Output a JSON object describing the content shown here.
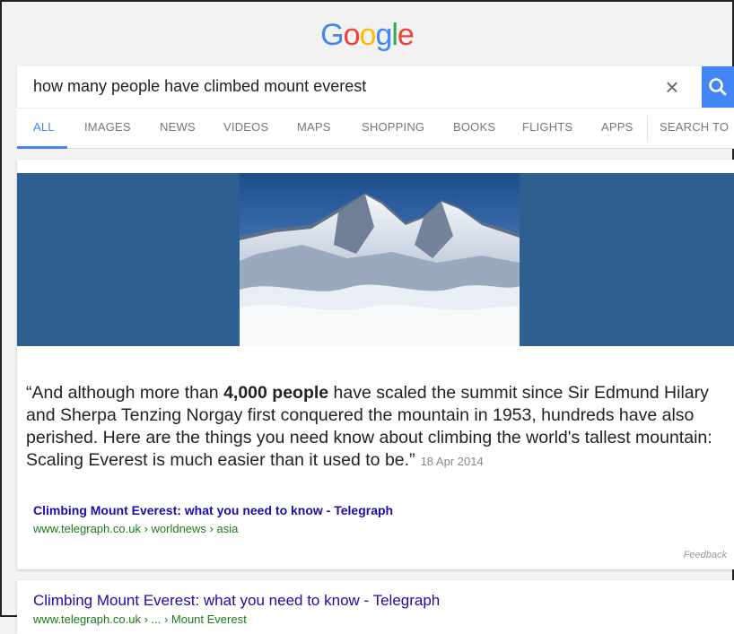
{
  "header": {
    "logo_letters": [
      {
        "ch": "G",
        "color": "#4285f4"
      },
      {
        "ch": "o",
        "color": "#ea4335"
      },
      {
        "ch": "o",
        "color": "#fbbc05"
      },
      {
        "ch": "g",
        "color": "#4285f4"
      },
      {
        "ch": "l",
        "color": "#34a853"
      },
      {
        "ch": "e",
        "color": "#ea4335"
      }
    ]
  },
  "search": {
    "query": "how many people have climbed mount everest",
    "clear_icon": "×",
    "button_color": "#4285f4"
  },
  "tabs": [
    {
      "label": "ALL",
      "active": true
    },
    {
      "label": "IMAGES"
    },
    {
      "label": "NEWS"
    },
    {
      "label": "VIDEOS"
    },
    {
      "label": "MAPS"
    },
    {
      "label": "SHOPPING"
    },
    {
      "label": "BOOKS"
    },
    {
      "label": "FLIGHTS"
    },
    {
      "label": "APPS"
    },
    {
      "label": "SEARCH TO"
    }
  ],
  "featured": {
    "quote_prefix": "“And although more than ",
    "quote_bold": "4,000 people",
    "quote_suffix": " have scaled the summit since Sir Edmund Hilary and Sherpa Tenzing Norgay first conquered the mountain in 1953, hundreds have also perished. Here are the things you need know about climbing the world's tallest mountain: Scaling Everest is much easier than it used to be.”",
    "date": "18 Apr 2014",
    "link_title": "Climbing Mount Everest: what you need to know - Telegraph",
    "url": "www.telegraph.co.uk › worldnews › asia",
    "feedback": "Feedback"
  },
  "result2": {
    "link_title": "Climbing Mount Everest: what you need to know - Telegraph",
    "url": "www.telegraph.co.uk › ... › Mount Everest"
  }
}
